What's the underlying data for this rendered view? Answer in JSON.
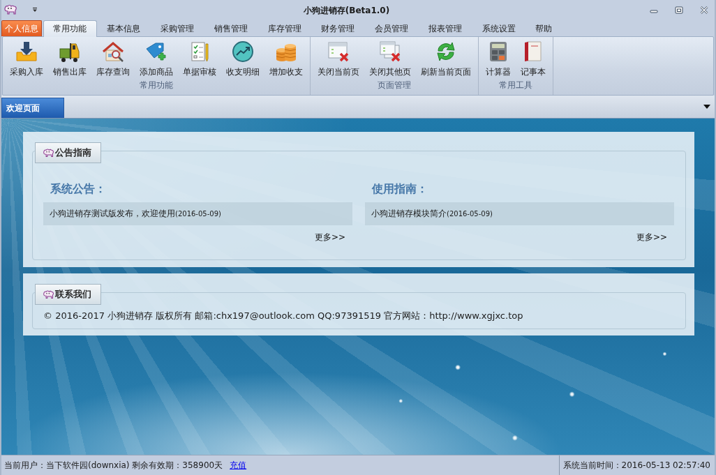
{
  "window": {
    "title": "小狗进销存(Beta1.0)"
  },
  "app_menu_button": {
    "label": "个人信息"
  },
  "tabs": [
    {
      "label": "常用功能",
      "selected": true
    },
    {
      "label": "基本信息",
      "selected": false
    },
    {
      "label": "采购管理",
      "selected": false
    },
    {
      "label": "销售管理",
      "selected": false
    },
    {
      "label": "库存管理",
      "selected": false
    },
    {
      "label": "财务管理",
      "selected": false
    },
    {
      "label": "会员管理",
      "selected": false
    },
    {
      "label": "报表管理",
      "selected": false
    },
    {
      "label": "系统设置",
      "selected": false
    },
    {
      "label": "帮助",
      "selected": false
    }
  ],
  "ribbon_groups": [
    {
      "title": "常用功能",
      "buttons": [
        {
          "label": "采购入库"
        },
        {
          "label": "销售出库"
        },
        {
          "label": "库存查询"
        },
        {
          "label": "添加商品"
        },
        {
          "label": "单据审核"
        },
        {
          "label": "收支明细"
        },
        {
          "label": "增加收支"
        }
      ]
    },
    {
      "title": "页面管理",
      "buttons": [
        {
          "label": "关闭当前页"
        },
        {
          "label": "关闭其他页"
        },
        {
          "label": "刷新当前页面"
        }
      ]
    },
    {
      "title": "常用工具",
      "buttons": [
        {
          "label": "计算器"
        },
        {
          "label": "记事本"
        }
      ]
    }
  ],
  "document_tabs": [
    {
      "label": "欢迎页面",
      "selected": true
    }
  ],
  "notice_panel": {
    "header": "公告指南",
    "columns": [
      {
        "heading": "系统公告：",
        "items": [
          {
            "title": "小狗进销存测试版发布，欢迎使用",
            "date": "(2016-05-09)"
          }
        ],
        "more": "更多>>"
      },
      {
        "heading": "使用指南：",
        "items": [
          {
            "title": "小狗进销存模块简介",
            "date": "(2016-05-09)"
          }
        ],
        "more": "更多>>"
      }
    ]
  },
  "contact_panel": {
    "header": "联系我们",
    "text": "© 2016-2017 小狗进销存 版权所有 邮箱:chx197@outlook.com QQ:97391519 官方网站：http://www.xgjxc.top"
  },
  "status_bar": {
    "user_info": "当前用户：当下软件园(downxia) 剩余有效期：358900天",
    "recharge_link": "充值",
    "time": "系统当前时间：2016-05-13 02:57:40"
  }
}
